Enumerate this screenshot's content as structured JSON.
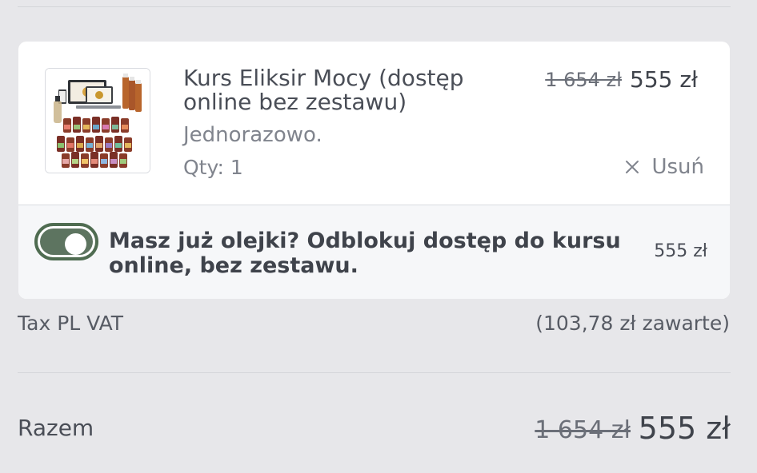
{
  "cart_item": {
    "title": "Kurs Eliksir Mocy (dostęp online bez zestawu)",
    "price_original": "1 654 zł",
    "price_current": "555 zł",
    "frequency": "Jednorazowo.",
    "quantity": "Qty: 1",
    "remove_label": "Usuń",
    "remove_icon": "close-icon"
  },
  "upsell": {
    "toggle_on": true,
    "text": "Masz już olejki? Odblokuj dostęp do kursu online, bez zestawu.",
    "price": "555 zł",
    "toggle_color": "#5d7460"
  },
  "summary": {
    "tax_label": "Tax PL VAT",
    "tax_value": "(103,78 zł zawarte)",
    "total_label": "Razem",
    "total_original": "1 654 zł",
    "total_current": "555 zł"
  }
}
